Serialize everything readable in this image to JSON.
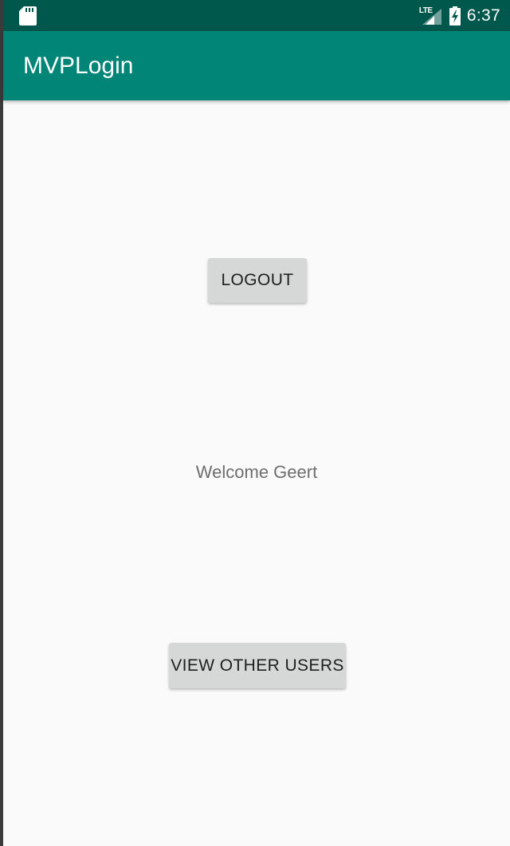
{
  "status_bar": {
    "network_label": "LTE",
    "time": "6:37"
  },
  "app_bar": {
    "title": "MVPLogin"
  },
  "main": {
    "logout_label": "LOGOUT",
    "welcome_text": "Welcome Geert",
    "view_users_label": "VIEW OTHER USERS"
  },
  "colors": {
    "status_bar": "#00574b",
    "app_bar": "#008577",
    "background": "#fafafa",
    "button": "#d6d7d7"
  },
  "icons": {
    "status_left": "sd-card-icon",
    "network": "signal-icon",
    "battery": "battery-charging-icon"
  }
}
